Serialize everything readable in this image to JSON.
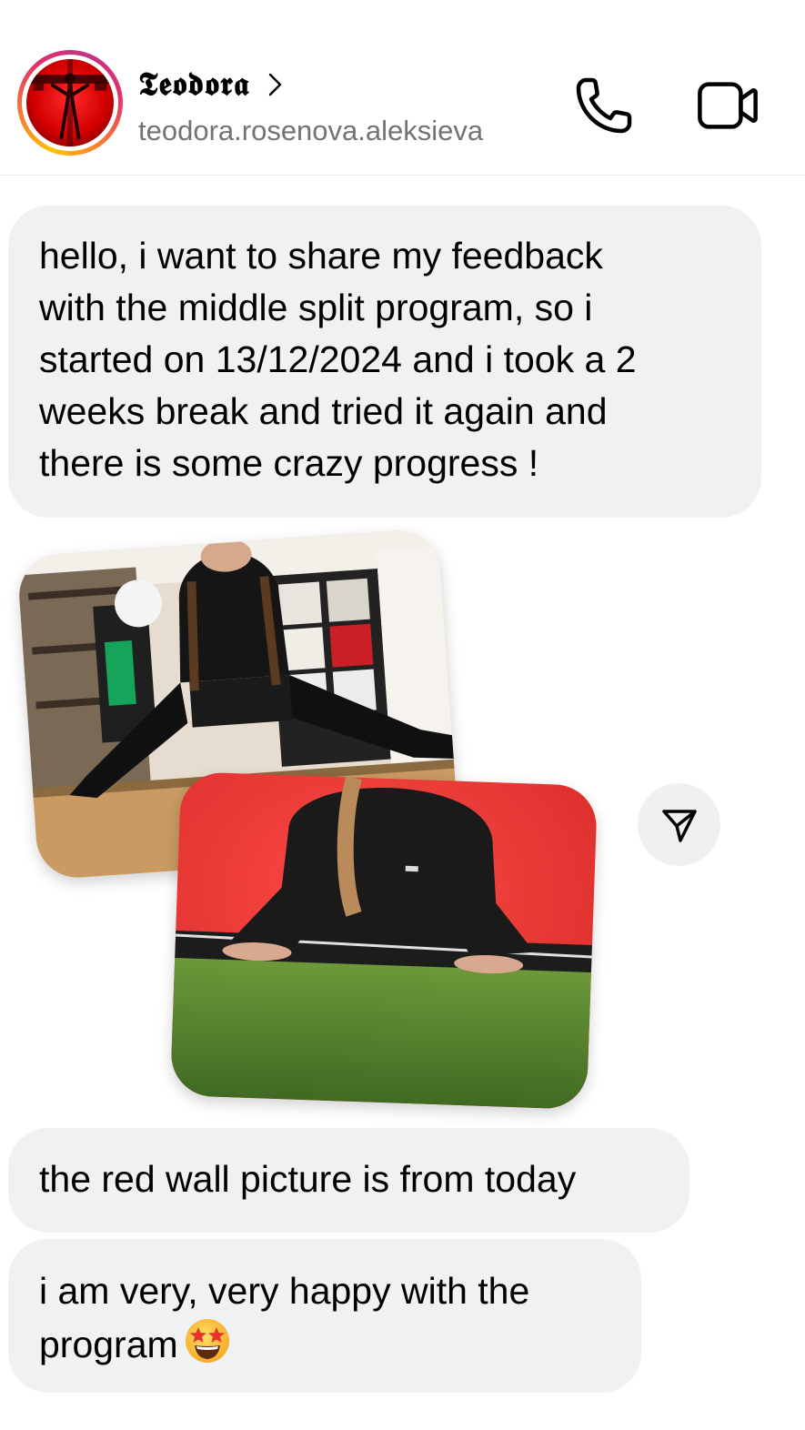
{
  "header": {
    "name": "𝕿𝖊𝖔𝖉𝖔𝖗𝖆",
    "username": "teodora.rosenova.aleksieva",
    "avatar_icon": "profile-avatar",
    "call_icon": "phone-icon",
    "video_icon": "video-camera-icon"
  },
  "messages": [
    {
      "lines": [
        "hello, i want to share my feedback",
        "with the middle split program, so i",
        "started on 13/12/2024 and i took a 2",
        "weeks break and tried it again and",
        "there is some crazy progress !"
      ]
    },
    {
      "lines": [
        "the red wall picture is from today"
      ]
    },
    {
      "lines": [
        "i am very, very happy with the",
        "program"
      ],
      "emoji": "star-struck"
    }
  ],
  "photos": [
    {
      "name": "split-photo-room"
    },
    {
      "name": "split-photo-red-wall"
    }
  ],
  "share_icon": "send-arrow-icon",
  "colors": {
    "bubble": "#f0f1f3",
    "username": "#737373",
    "red_wall": "#e83a35",
    "turf": "#5a8a2e"
  }
}
